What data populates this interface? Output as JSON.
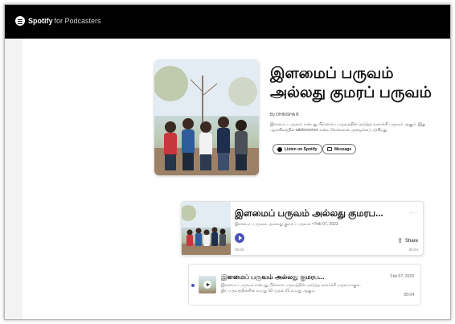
{
  "brand": {
    "name": "Spotify",
    "suffix": "for Podcasters"
  },
  "podcast": {
    "title": "இளமைப் பருவம் அல்லது குமரப் பருவம்",
    "byline": "By DHINISHA B",
    "description": "இளமைப் பருவம் என்பது பிள்ளைப் பருவத்தின் அடுத்த வளர்ச்சி பருவம் ஆகும். இது ஆங்கிலத்தில் adolescence என்ற சொல்லால் அழைக்கப்படுகிறது.",
    "listen_label": "Listen on Spotify",
    "message_label": "Message"
  },
  "embed": {
    "title": "இளமைப் பருவம் அல்லது குமரப...",
    "subtitle": "இளமைப் பருவம் அல்லது குமரப் பருவம் • Feb 07, 2023",
    "more": "···",
    "time_elapsed": "00:00",
    "time_total": "05:04",
    "share_label": "Share"
  },
  "episode": {
    "title": "இளமைப் பருவம் அல்லது குமரப...",
    "description": "இளமைப் பருவம் என்பது பிள்ளை பருவத்தின் அடுத்த வளர்ச்சி பருவமாகும். இப்பருவத்தினரின் வயது 10 முதல் 21 வயது ஆகும்.",
    "date": "Feb 07, 2023",
    "duration": "05:04"
  },
  "colors": {
    "topbar": "#000000",
    "accent": "#4b54b8"
  },
  "icons": {
    "brand": "spotify-logo",
    "share": "share-icon",
    "play": "play-icon",
    "message": "message-icon",
    "more": "more-icon"
  }
}
